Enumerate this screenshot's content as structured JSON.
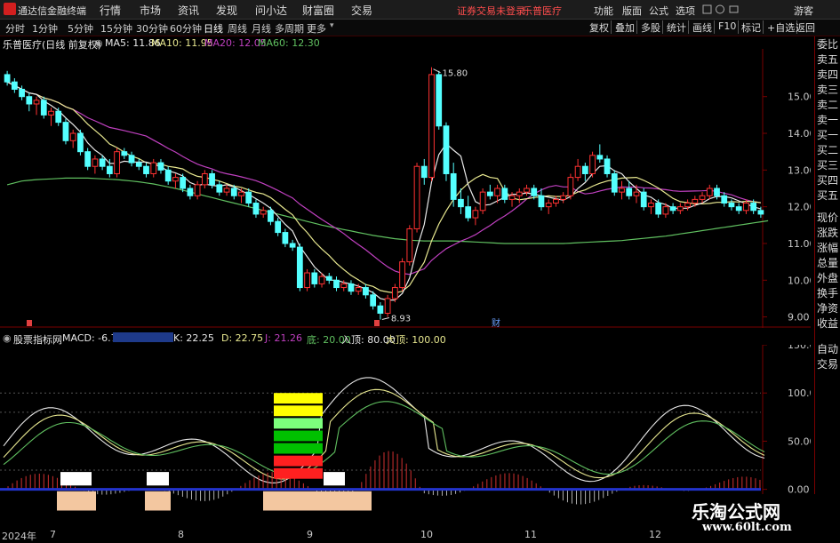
{
  "titlebar": {
    "app_title": "通达信金融终端",
    "menu": [
      "行情",
      "市场",
      "资讯",
      "发现",
      "问小达",
      "财富圈",
      "交易"
    ],
    "notice_login": "证券交易未登录",
    "notice_stock": "乐普医疗",
    "tools": [
      "功能",
      "版面",
      "公式",
      "选项"
    ],
    "guest": "游客"
  },
  "period_tabs": [
    "分时",
    "1分钟",
    "5分钟",
    "15分钟",
    "30分钟",
    "60分钟",
    "日线",
    "周线",
    "月线",
    "多周期",
    "更多"
  ],
  "active_period": "日线",
  "toolbar": [
    "复权",
    "叠加",
    "多股",
    "统计",
    "画线",
    "F10",
    "标记",
    "+自选",
    "返回"
  ],
  "stock": {
    "name": "乐普医疗(日线 前复权)",
    "ma5": "MA5: 11.86",
    "ma10": "MA10: 11.95",
    "ma20": "MA20: 12.05",
    "ma60": "MA60: 12.30",
    "high_label": "15.80",
    "low_label": "8.93",
    "fin_marker": "财"
  },
  "right_panel": [
    "委比",
    "卖五",
    "卖四",
    "卖三",
    "卖二",
    "卖一",
    "买一",
    "买二",
    "买三",
    "买四",
    "买五",
    "现价",
    "涨跌",
    "涨幅",
    "总量",
    "外盘",
    "换手",
    "净资",
    "收益",
    "自动",
    "交易"
  ],
  "indicator": {
    "name": "股票指标网",
    "macd": "MACD: -6.70",
    "k": "K: 22.25",
    "d": "D: 22.75",
    "j": "J: 21.26",
    "di": "底: 20.00",
    "rumen": "入顶: 80.00",
    "dading": "大顶: 100.00"
  },
  "colors": {
    "up": "#ff3232",
    "down": "#54ffff",
    "ma5": "#e8e8e8",
    "ma10": "#e8e890",
    "ma20": "#c040c0",
    "ma60": "#60c060",
    "grid": "#7a0000"
  },
  "x_axis": [
    "2024年",
    "7",
    "8",
    "9",
    "10",
    "11",
    "12"
  ],
  "watermark": {
    "title": "乐淘公式网",
    "url": "www.60lt.com"
  },
  "chart_data": [
    {
      "type": "candlestick",
      "title": "乐普医疗(日线 前复权)",
      "ylim": [
        8.7,
        16.3
      ],
      "y_ticks": [
        15.0,
        14.0,
        13.0,
        12.0,
        11.0,
        10.0,
        9.0
      ],
      "candles": [
        [
          15.6,
          15.7,
          15.3,
          15.4
        ],
        [
          15.4,
          15.5,
          15.1,
          15.2
        ],
        [
          15.2,
          15.3,
          14.9,
          15.0
        ],
        [
          15.0,
          15.1,
          14.6,
          14.8
        ],
        [
          14.8,
          15.0,
          14.5,
          14.9
        ],
        [
          14.9,
          15.0,
          14.4,
          14.5
        ],
        [
          14.5,
          14.7,
          14.2,
          14.6
        ],
        [
          14.6,
          14.7,
          14.2,
          14.3
        ],
        [
          14.3,
          14.4,
          13.7,
          13.8
        ],
        [
          13.8,
          14.1,
          13.6,
          14.0
        ],
        [
          14.0,
          14.1,
          13.4,
          13.5
        ],
        [
          13.5,
          13.6,
          13.0,
          13.1
        ],
        [
          13.1,
          13.4,
          12.9,
          13.3
        ],
        [
          13.3,
          13.4,
          13.0,
          13.1
        ],
        [
          13.1,
          13.3,
          12.8,
          12.9
        ],
        [
          12.9,
          13.6,
          12.8,
          13.5
        ],
        [
          13.5,
          13.6,
          13.3,
          13.4
        ],
        [
          13.4,
          13.5,
          13.1,
          13.2
        ],
        [
          13.2,
          13.3,
          13.0,
          13.1
        ],
        [
          13.1,
          13.2,
          12.8,
          12.9
        ],
        [
          12.9,
          13.3,
          12.8,
          13.2
        ],
        [
          13.2,
          13.3,
          12.9,
          13.0
        ],
        [
          13.0,
          13.1,
          12.6,
          12.7
        ],
        [
          12.7,
          12.9,
          12.5,
          12.8
        ],
        [
          12.8,
          12.9,
          12.4,
          12.5
        ],
        [
          12.5,
          12.6,
          12.2,
          12.3
        ],
        [
          12.3,
          12.7,
          12.2,
          12.6
        ],
        [
          12.6,
          13.0,
          12.5,
          12.9
        ],
        [
          12.9,
          13.0,
          12.5,
          12.6
        ],
        [
          12.6,
          12.7,
          12.3,
          12.4
        ],
        [
          12.4,
          12.6,
          12.3,
          12.5
        ],
        [
          12.5,
          12.6,
          12.2,
          12.3
        ],
        [
          12.3,
          12.5,
          12.1,
          12.4
        ],
        [
          12.4,
          12.5,
          12.0,
          12.1
        ],
        [
          12.1,
          12.2,
          11.7,
          11.8
        ],
        [
          11.8,
          12.0,
          11.7,
          11.9
        ],
        [
          11.9,
          12.0,
          11.5,
          11.6
        ],
        [
          11.6,
          11.7,
          11.2,
          11.3
        ],
        [
          11.3,
          11.4,
          10.9,
          11.0
        ],
        [
          11.0,
          11.1,
          10.8,
          10.9
        ],
        [
          10.9,
          11.0,
          9.7,
          9.8
        ],
        [
          9.8,
          10.3,
          9.7,
          10.2
        ],
        [
          10.2,
          10.3,
          9.8,
          9.9
        ],
        [
          9.9,
          10.2,
          9.8,
          10.1
        ],
        [
          10.1,
          10.2,
          9.9,
          10.0
        ],
        [
          10.0,
          10.1,
          9.7,
          9.8
        ],
        [
          9.8,
          10.0,
          9.7,
          9.9
        ],
        [
          9.9,
          10.0,
          9.6,
          9.7
        ],
        [
          9.7,
          9.9,
          9.6,
          9.8
        ],
        [
          9.8,
          9.9,
          9.5,
          9.6
        ],
        [
          9.6,
          9.7,
          9.2,
          9.3
        ],
        [
          9.3,
          9.4,
          8.93,
          9.1
        ],
        [
          9.1,
          9.6,
          9.0,
          9.5
        ],
        [
          9.5,
          9.9,
          9.4,
          9.8
        ],
        [
          9.8,
          10.6,
          9.7,
          10.5
        ],
        [
          10.5,
          11.5,
          10.4,
          11.4
        ],
        [
          11.4,
          13.2,
          11.3,
          13.1
        ],
        [
          13.1,
          13.3,
          12.6,
          12.8
        ],
        [
          12.8,
          15.8,
          12.7,
          15.6
        ],
        [
          15.6,
          15.7,
          14.1,
          14.2
        ],
        [
          14.2,
          14.3,
          12.7,
          12.9
        ],
        [
          12.9,
          13.2,
          12.0,
          12.2
        ],
        [
          12.2,
          12.5,
          11.8,
          12.0
        ],
        [
          12.0,
          12.3,
          11.6,
          11.7
        ],
        [
          11.7,
          12.0,
          11.5,
          11.9
        ],
        [
          11.9,
          12.5,
          11.8,
          12.4
        ],
        [
          12.4,
          12.6,
          12.2,
          12.3
        ],
        [
          12.3,
          12.6,
          12.1,
          12.5
        ],
        [
          12.5,
          12.6,
          12.1,
          12.2
        ],
        [
          12.2,
          12.4,
          12.0,
          12.3
        ],
        [
          12.3,
          12.5,
          12.1,
          12.4
        ],
        [
          12.4,
          12.6,
          12.3,
          12.5
        ],
        [
          12.5,
          12.6,
          12.2,
          12.3
        ],
        [
          12.3,
          12.5,
          11.9,
          12.0
        ],
        [
          12.0,
          12.2,
          11.8,
          12.1
        ],
        [
          12.1,
          12.3,
          12.0,
          12.2
        ],
        [
          12.2,
          12.4,
          12.1,
          12.3
        ],
        [
          12.3,
          12.9,
          12.2,
          12.8
        ],
        [
          12.8,
          13.3,
          12.7,
          13.1
        ],
        [
          13.1,
          13.2,
          12.7,
          12.9
        ],
        [
          12.9,
          13.5,
          12.8,
          13.4
        ],
        [
          13.4,
          13.7,
          13.2,
          13.3
        ],
        [
          13.3,
          13.4,
          12.8,
          12.9
        ],
        [
          12.9,
          13.0,
          12.3,
          12.4
        ],
        [
          12.4,
          12.7,
          12.2,
          12.5
        ],
        [
          12.5,
          12.7,
          12.2,
          12.3
        ],
        [
          12.3,
          12.6,
          12.1,
          12.4
        ],
        [
          12.4,
          12.5,
          11.9,
          12.0
        ],
        [
          12.0,
          12.2,
          11.8,
          12.1
        ],
        [
          12.1,
          12.2,
          11.7,
          11.8
        ],
        [
          11.8,
          12.1,
          11.7,
          12.0
        ],
        [
          12.0,
          12.1,
          11.8,
          11.9
        ],
        [
          11.9,
          12.1,
          11.8,
          12.0
        ],
        [
          12.0,
          12.2,
          11.9,
          12.1
        ],
        [
          12.1,
          12.3,
          12.0,
          12.2
        ],
        [
          12.2,
          12.4,
          12.1,
          12.3
        ],
        [
          12.3,
          12.6,
          12.2,
          12.5
        ],
        [
          12.5,
          12.6,
          12.2,
          12.3
        ],
        [
          12.3,
          12.4,
          12.0,
          12.1
        ],
        [
          12.1,
          12.2,
          11.9,
          12.0
        ],
        [
          12.0,
          12.1,
          11.8,
          11.9
        ],
        [
          11.9,
          12.2,
          11.8,
          12.1
        ],
        [
          12.1,
          12.2,
          11.8,
          11.9
        ],
        [
          11.9,
          12.0,
          11.7,
          11.8
        ]
      ],
      "ma60": [
        12.6,
        12.65,
        12.7,
        12.72,
        12.74,
        12.75,
        12.76,
        12.77,
        12.78,
        12.78,
        12.78,
        12.78,
        12.77,
        12.76,
        12.75,
        12.74,
        12.72,
        12.7,
        12.68,
        12.65,
        12.62,
        12.58,
        12.54,
        12.5,
        12.45,
        12.4,
        12.35,
        12.3,
        12.25,
        12.2,
        12.15,
        12.1,
        12.05,
        12.0,
        11.95,
        11.9,
        11.85,
        11.8,
        11.75,
        11.7,
        11.65,
        11.6,
        11.55,
        11.5,
        11.46,
        11.42,
        11.38,
        11.34,
        11.3,
        11.26,
        11.22,
        11.19,
        11.16,
        11.13,
        11.11,
        11.09,
        11.08,
        11.07,
        11.07,
        11.07,
        11.07,
        11.07,
        11.06,
        11.05,
        11.04,
        11.03,
        11.02,
        11.01,
        11.0,
        11.0,
        11.0,
        11.0,
        11.0,
        11.0,
        11.0,
        11.0,
        11.0,
        11.01,
        11.02,
        11.03,
        11.04,
        11.05,
        11.06,
        11.07,
        11.08,
        11.1,
        11.12,
        11.14,
        11.16,
        11.18,
        11.2,
        11.23,
        11.26,
        11.29,
        11.32,
        11.35,
        11.38,
        11.41,
        11.44,
        11.47,
        11.5,
        11.53,
        11.56,
        11.59,
        11.62
      ]
    },
    {
      "type": "line",
      "title": "股票指标网",
      "ylim": [
        -40,
        150
      ],
      "y_ticks": [
        150.0,
        100.0,
        50.0,
        0.0
      ],
      "reference_lines": [
        100,
        80,
        20
      ]
    }
  ]
}
